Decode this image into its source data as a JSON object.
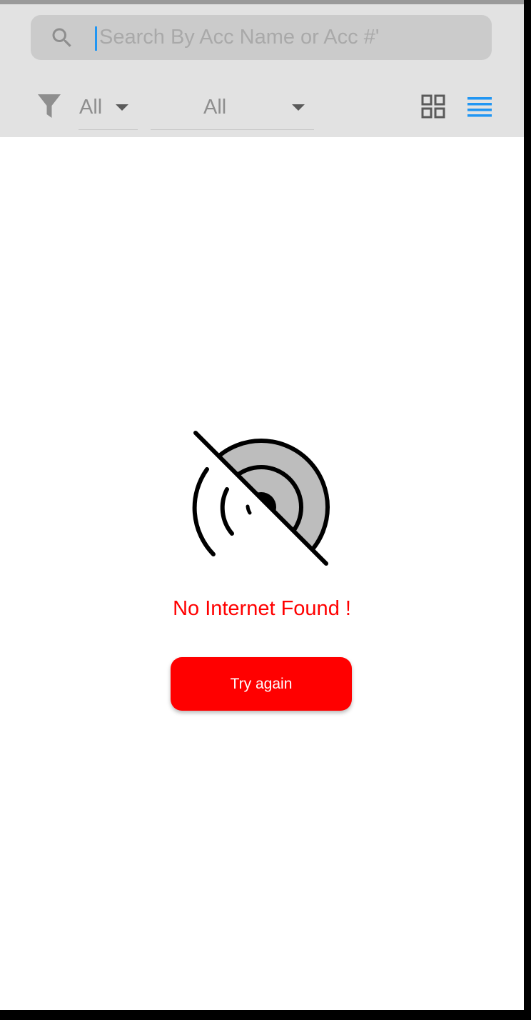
{
  "search": {
    "placeholder": "Search By Acc Name or Acc #'",
    "value": ""
  },
  "filters": {
    "icon": "filter-icon",
    "first": {
      "selected": "All"
    },
    "second": {
      "selected": "All"
    }
  },
  "view_toggle": {
    "grid_icon": "grid-view-icon",
    "list_icon": "list-view-icon",
    "active": "list",
    "active_color": "#2196f3",
    "inactive_color": "#5a5a5a"
  },
  "empty_state": {
    "icon": "no-signal-icon",
    "message": "No Internet Found !",
    "message_color": "#ff0000",
    "retry_label": "Try again",
    "retry_color": "#ff0000"
  }
}
